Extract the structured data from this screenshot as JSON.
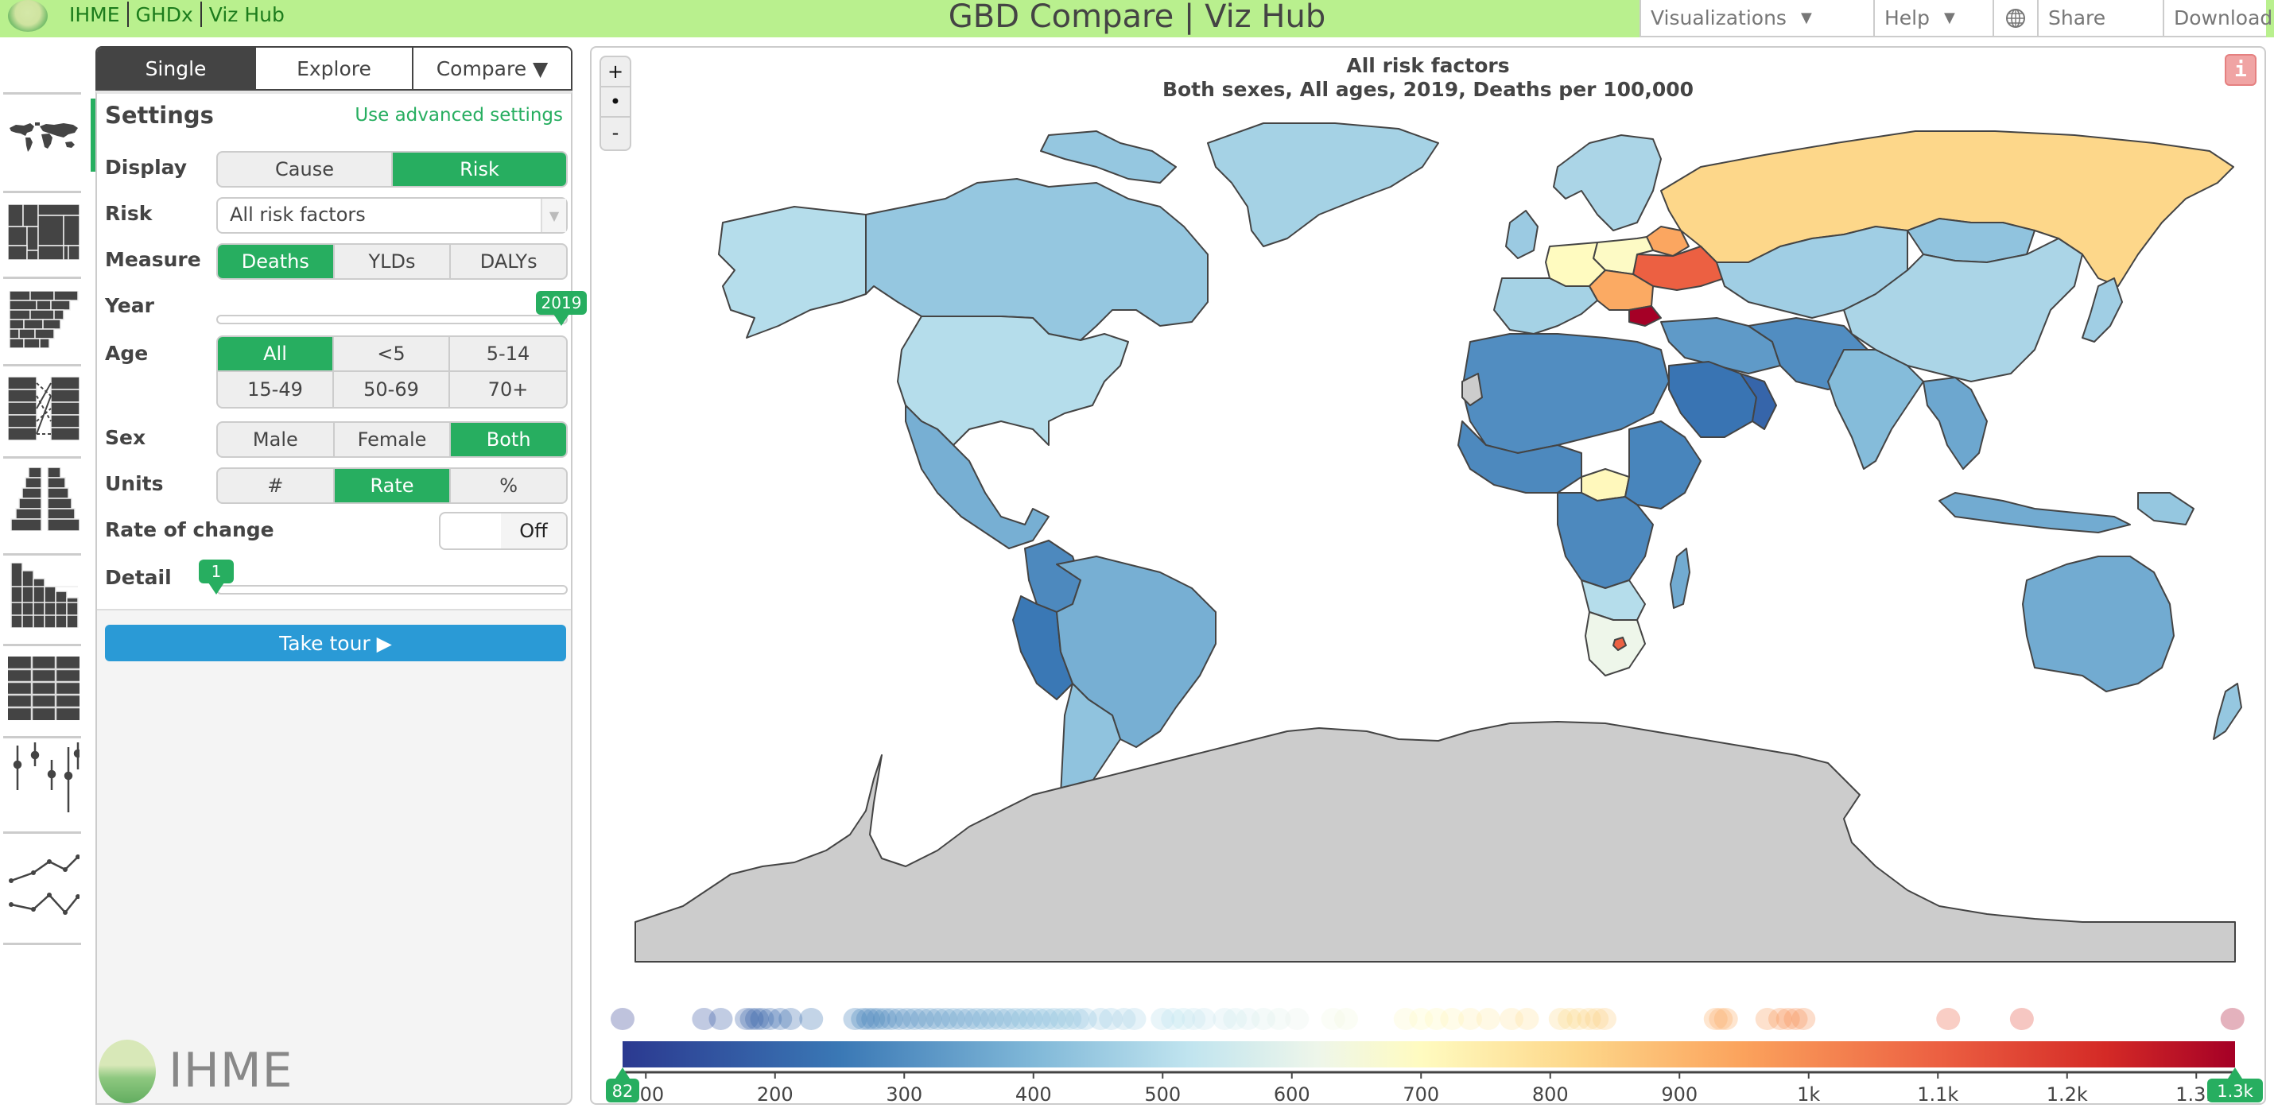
{
  "header": {
    "brand_links": [
      "IHME",
      "GHDx",
      "Viz Hub"
    ],
    "title": "GBD Compare | Viz Hub",
    "nav": {
      "visualizations": "Visualizations",
      "help": "Help",
      "globe_icon": "globe-icon",
      "share": "Share",
      "download": "Download"
    }
  },
  "rail": {
    "items": [
      {
        "name": "map-view",
        "icon": "world-map-icon",
        "active": true
      },
      {
        "name": "treemap-view",
        "icon": "treemap-icon",
        "active": false
      },
      {
        "name": "stacked-bar-view",
        "icon": "stacked-bars-icon",
        "active": false
      },
      {
        "name": "arrow-diagram-view",
        "icon": "arrow-diagram-icon",
        "active": false
      },
      {
        "name": "pyramid-view",
        "icon": "pyramid-icon",
        "active": false
      },
      {
        "name": "pattern-view",
        "icon": "pattern-bars-icon",
        "active": false
      },
      {
        "name": "heatmap-view",
        "icon": "heatmap-grid-icon",
        "active": false
      },
      {
        "name": "uncertainty-view",
        "icon": "uncertainty-intervals-icon",
        "active": false
      },
      {
        "name": "time-plot-view",
        "icon": "line-chart-icon",
        "active": false
      }
    ]
  },
  "tabs": [
    {
      "label": "Single",
      "active": true
    },
    {
      "label": "Explore",
      "active": false
    },
    {
      "label": "Compare ▼",
      "active": false
    }
  ],
  "settings": {
    "title": "Settings",
    "advanced_link": "Use advanced settings",
    "display": {
      "label": "Display",
      "options": [
        "Cause",
        "Risk"
      ],
      "selected": "Risk"
    },
    "risk": {
      "label": "Risk",
      "value": "All risk factors"
    },
    "measure": {
      "label": "Measure",
      "options": [
        "Deaths",
        "YLDs",
        "DALYs"
      ],
      "selected": "Deaths"
    },
    "year": {
      "label": "Year",
      "value": "2019",
      "fraction": 1.0
    },
    "age": {
      "label": "Age",
      "options": [
        "All",
        "<5",
        "5-14",
        "15-49",
        "50-69",
        "70+"
      ],
      "selected": "All"
    },
    "sex": {
      "label": "Sex",
      "options": [
        "Male",
        "Female",
        "Both"
      ],
      "selected": "Both"
    },
    "units": {
      "label": "Units",
      "options": [
        "#",
        "Rate",
        "%"
      ],
      "selected": "Rate"
    },
    "rate_of_change": {
      "label": "Rate of change",
      "state": "Off"
    },
    "detail": {
      "label": "Detail",
      "value": "1",
      "fraction": 0.0
    },
    "tour_button": "Take tour ▶",
    "footer_logo": "IHME"
  },
  "map": {
    "zoom_in": "+",
    "zoom_reset": "•",
    "zoom_out": "-",
    "title": "All risk factors",
    "subtitle": "Both sexes, All ages, 2019, Deaths per 100,000",
    "info_icon": "i",
    "colors": {
      "no_data": "#cccccc",
      "border": "#444444"
    }
  },
  "chart_data": {
    "type": "choropleth",
    "title": "All risk factors",
    "subtitle": "Both sexes, All ages, 2019, Deaths per 100,000",
    "legend": {
      "min_marker": "82",
      "max_marker": "1.3k",
      "range": [
        82,
        1330
      ],
      "ticks": [
        "100",
        "200",
        "300",
        "400",
        "500",
        "600",
        "700",
        "800",
        "900",
        "1k",
        "1.1k",
        "1.2k",
        "1.3k"
      ],
      "tick_values": [
        100,
        200,
        300,
        400,
        500,
        600,
        700,
        800,
        900,
        1000,
        1100,
        1200,
        1300
      ],
      "color_stops": [
        {
          "v": 82,
          "c": "#2b3990"
        },
        {
          "v": 250,
          "c": "#3a78b5"
        },
        {
          "v": 400,
          "c": "#80b8d8"
        },
        {
          "v": 520,
          "c": "#c0e4ef"
        },
        {
          "v": 620,
          "c": "#eef6ea"
        },
        {
          "v": 700,
          "c": "#fffbc0"
        },
        {
          "v": 820,
          "c": "#fdd78a"
        },
        {
          "v": 950,
          "c": "#fba25c"
        },
        {
          "v": 1100,
          "c": "#ec6042"
        },
        {
          "v": 1230,
          "c": "#d42a26"
        },
        {
          "v": 1330,
          "c": "#a50026"
        }
      ],
      "distribution_values": [
        82,
        145,
        158,
        178,
        182,
        186,
        190,
        196,
        204,
        212,
        228,
        262,
        268,
        272,
        276,
        280,
        285,
        290,
        296,
        302,
        308,
        314,
        320,
        326,
        332,
        338,
        344,
        350,
        356,
        362,
        368,
        374,
        380,
        386,
        392,
        398,
        404,
        410,
        416,
        422,
        428,
        434,
        440,
        452,
        460,
        470,
        478,
        500,
        508,
        516,
        524,
        532,
        548,
        556,
        566,
        578,
        590,
        604,
        632,
        642,
        688,
        700,
        712,
        724,
        738,
        752,
        770,
        782,
        808,
        815,
        822,
        830,
        836,
        842,
        928,
        932,
        936,
        968,
        978,
        984,
        990,
        996,
        1108,
        1165,
        1328
      ]
    },
    "regions": [
      {
        "name": "Russia",
        "value": 820
      },
      {
        "name": "Ukraine",
        "value": 1100
      },
      {
        "name": "Bulgaria",
        "value": 1330
      },
      {
        "name": "Belarus",
        "value": 940
      },
      {
        "name": "Germany",
        "value": 700
      },
      {
        "name": "Poland",
        "value": 690
      },
      {
        "name": "Hungary/Serbia/Romania",
        "value": 930
      },
      {
        "name": "Central African Republic",
        "value": 710
      },
      {
        "name": "Lesotho",
        "value": 1100
      },
      {
        "name": "South Africa",
        "value": 620
      },
      {
        "name": "United States",
        "value": 500
      },
      {
        "name": "Canada",
        "value": 440
      },
      {
        "name": "Greenland",
        "value": 470
      },
      {
        "name": "Alaska",
        "value": 500
      },
      {
        "name": "Mexico",
        "value": 380
      },
      {
        "name": "Brazil",
        "value": 380
      },
      {
        "name": "Peru",
        "value": 250
      },
      {
        "name": "Colombia",
        "value": 290
      },
      {
        "name": "Argentina",
        "value": 430
      },
      {
        "name": "China",
        "value": 480
      },
      {
        "name": "India",
        "value": 410
      },
      {
        "name": "Saudi Arabia",
        "value": 240
      },
      {
        "name": "Oman",
        "value": 200
      },
      {
        "name": "Australia",
        "value": 370
      },
      {
        "name": "Western Sahara",
        "value": null
      },
      {
        "name": "Antarctica",
        "value": null
      }
    ]
  }
}
